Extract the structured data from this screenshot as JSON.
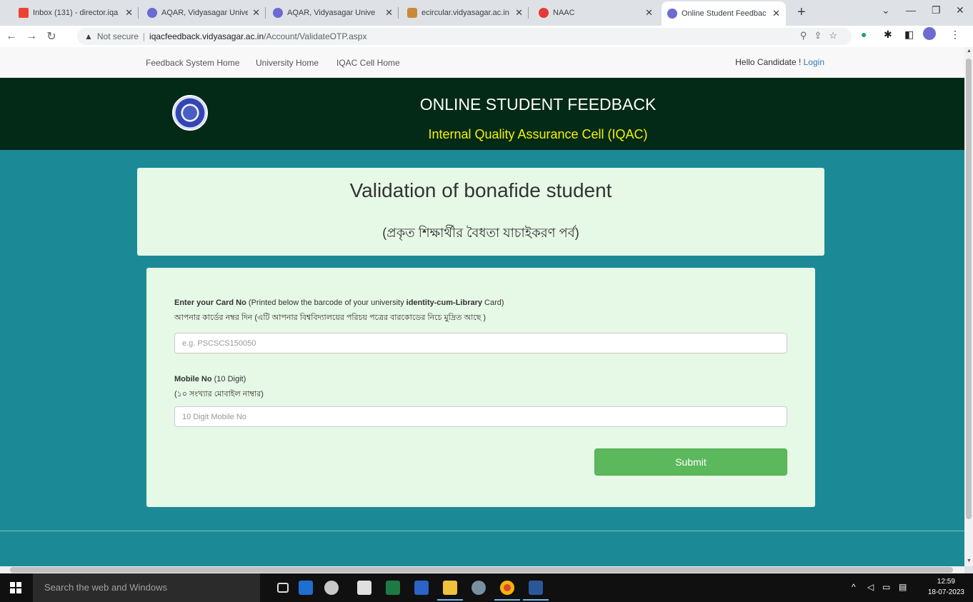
{
  "browser": {
    "tabs": [
      {
        "title": "Inbox (131) - director.iqa"
      },
      {
        "title": "AQAR, Vidyasagar Unive"
      },
      {
        "title": "AQAR, Vidyasagar Unive"
      },
      {
        "title": "ecircular.vidyasagar.ac.in"
      },
      {
        "title": "NAAC"
      },
      {
        "title": "Online Student Feedbac"
      }
    ],
    "security_label": "Not secure",
    "url_host": "iqacfeedback.vidyasagar.ac.in",
    "url_path": "/Account/ValidateOTP.aspx"
  },
  "nav": {
    "links": [
      "Feedback System Home",
      "University Home",
      "IQAC Cell Home"
    ],
    "greeting": "Hello Candidate ! ",
    "login": "Login"
  },
  "banner": {
    "title": "ONLINE STUDENT FEEDBACK",
    "subtitle": "Internal Quality Assurance Cell (IQAC)"
  },
  "header_card": {
    "title": "Validation of bonafide student",
    "subtitle_bn": "(প্রকৃত শিক্ষার্থীর বৈধতা যাচাইকরণ পর্ব)"
  },
  "form": {
    "card_label_bold": "Enter your Card No",
    "card_label_rest_1": " (Printed below the barcode of your university ",
    "card_label_bold_2": "identity-cum-Library",
    "card_label_rest_2": " Card)",
    "card_label_bn": "আপনার কার্ডের নম্বর দিন (এটি আপনার বিশ্ববিদ্যালয়ের পরিচয় পত্রের বারকোডের নিচে মুদ্রিত আছে )",
    "card_placeholder": "e.g. PSCSCS150050",
    "mobile_label_bold": "Mobile No",
    "mobile_label_rest": " (10 Digit)",
    "mobile_label_bn": "(১০ সংখ্যার মোবাইল নাম্বার)",
    "mobile_placeholder": "10 Digit Mobile No",
    "submit_label": "Submit"
  },
  "taskbar": {
    "search_placeholder": "Search the web and Windows",
    "time": "12:59",
    "date": "18-07-2023"
  }
}
